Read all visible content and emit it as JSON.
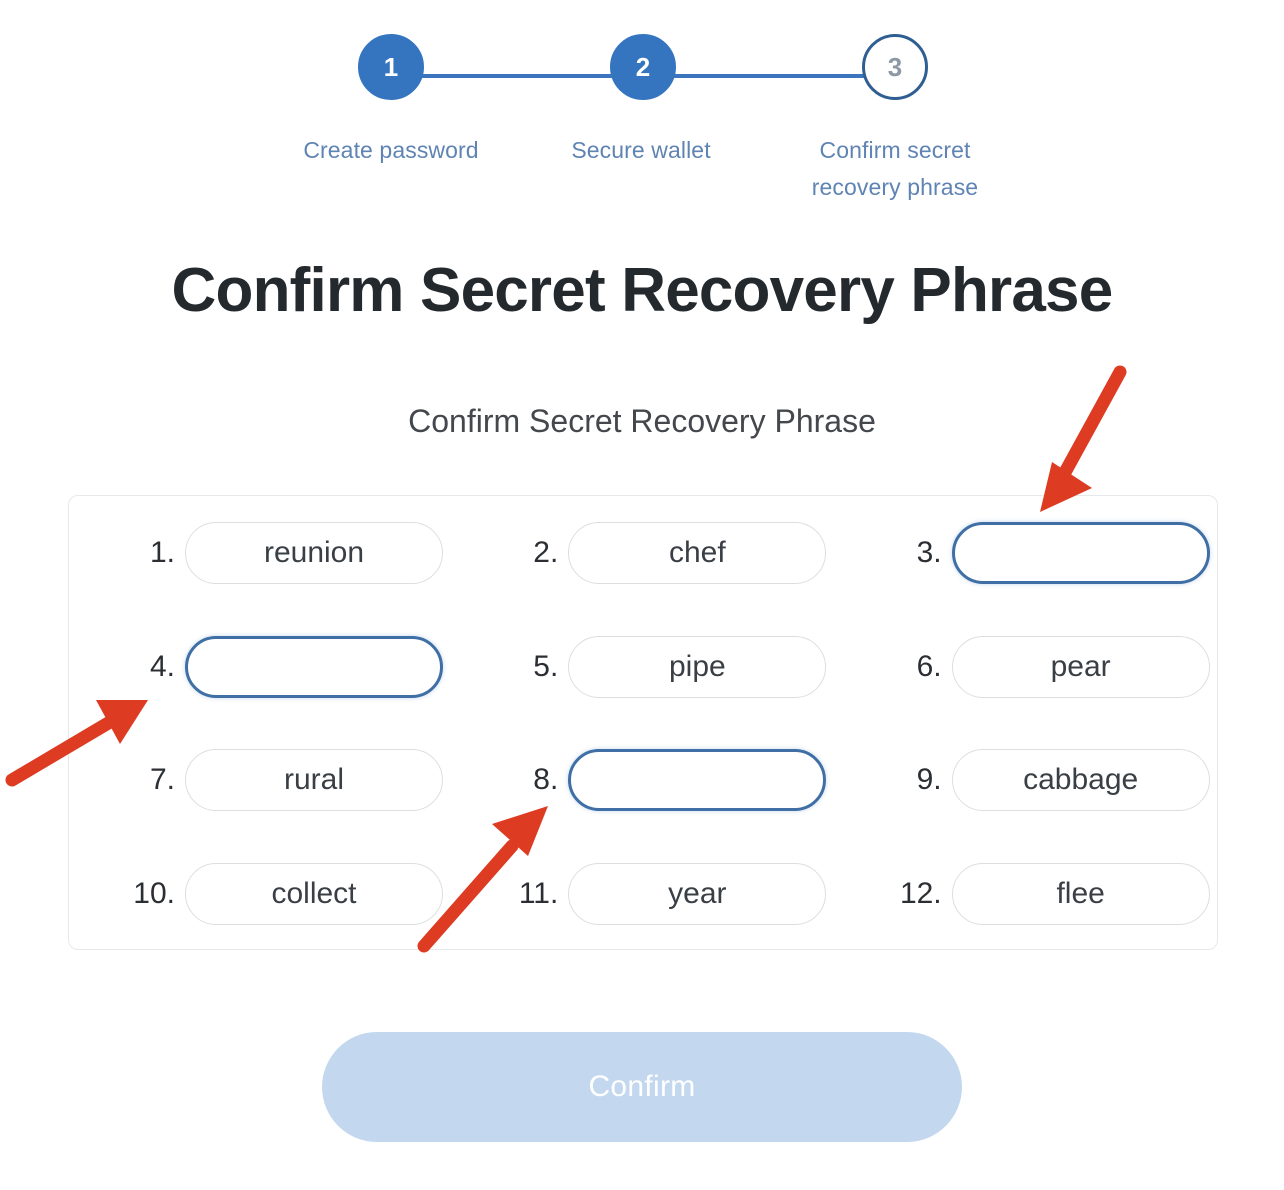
{
  "stepper": {
    "steps": [
      {
        "number": "1",
        "label": "Create password",
        "state": "complete"
      },
      {
        "number": "2",
        "label": "Secure wallet",
        "state": "complete"
      },
      {
        "number": "3",
        "label_line1": "Confirm secret",
        "label_line2": "recovery phrase",
        "state": "current"
      }
    ],
    "active_color": "#3575c0",
    "label_color": "#5f84b4",
    "line_color": "#3b75bd"
  },
  "page": {
    "title": "Confirm Secret Recovery Phrase",
    "subtitle": "Confirm Secret Recovery Phrase"
  },
  "words": [
    {
      "index": "1.",
      "value": "reunion",
      "empty": false
    },
    {
      "index": "2.",
      "value": "chef",
      "empty": false
    },
    {
      "index": "3.",
      "value": "",
      "empty": true
    },
    {
      "index": "4.",
      "value": "",
      "empty": true
    },
    {
      "index": "5.",
      "value": "pipe",
      "empty": false
    },
    {
      "index": "6.",
      "value": "pear",
      "empty": false
    },
    {
      "index": "7.",
      "value": "rural",
      "empty": false
    },
    {
      "index": "8.",
      "value": "",
      "empty": true
    },
    {
      "index": "9.",
      "value": "cabbage",
      "empty": false
    },
    {
      "index": "10.",
      "value": "collect",
      "empty": false
    },
    {
      "index": "11.",
      "value": "year",
      "empty": false
    },
    {
      "index": "12.",
      "value": "flee",
      "empty": false
    }
  ],
  "confirm_button": {
    "label": "Confirm",
    "enabled": false,
    "fill_color": "#c3d8ef",
    "text_color": "#ffffff"
  },
  "annotations": {
    "arrow_color": "#dd3b22",
    "arrows": [
      {
        "name": "arrow-to-word-3",
        "points_to": "3."
      },
      {
        "name": "arrow-to-word-4",
        "points_to": "4."
      },
      {
        "name": "arrow-to-word-8",
        "points_to": "8."
      }
    ]
  }
}
